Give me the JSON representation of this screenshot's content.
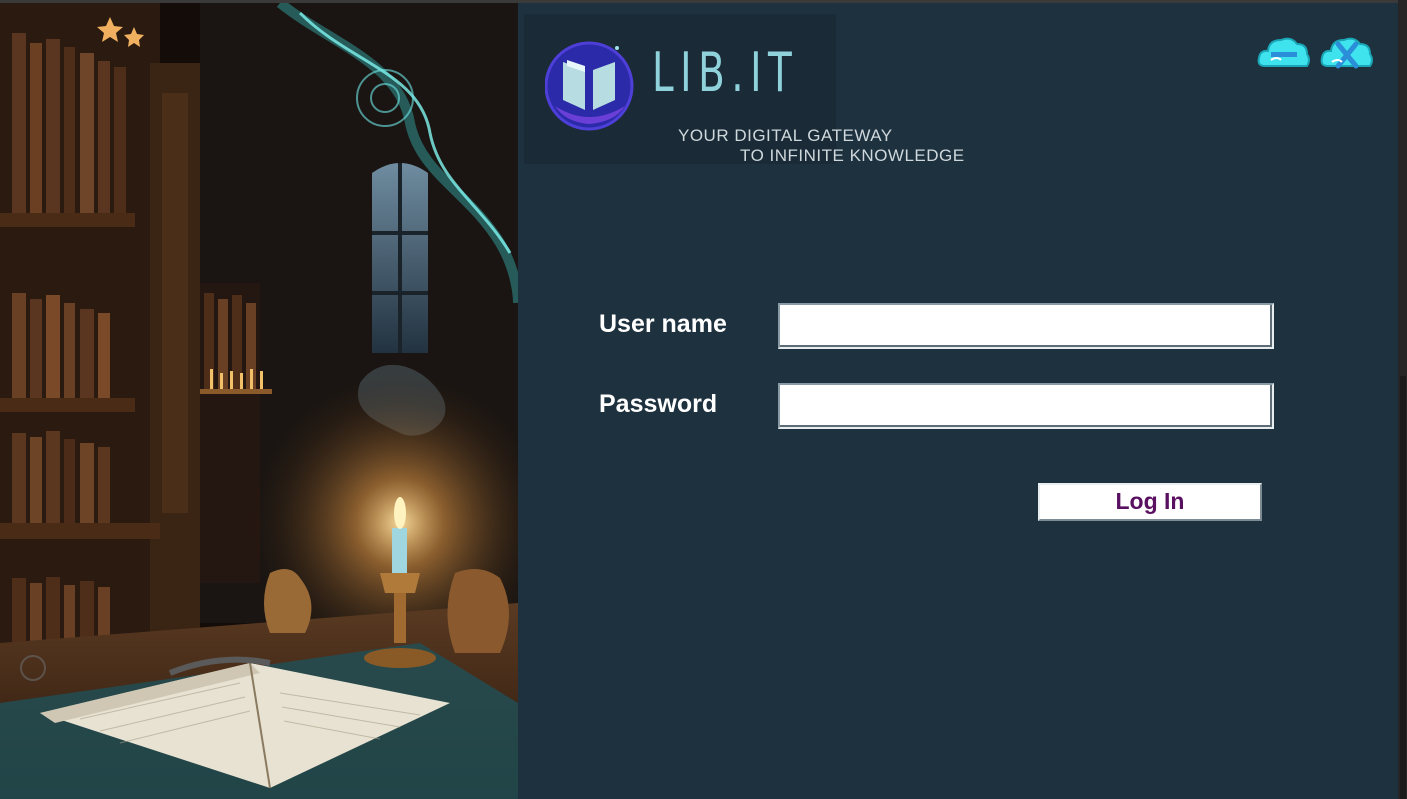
{
  "app": {
    "logo_text": "LIB.IT",
    "tagline_line1": "YOUR DIGITAL GATEWAY",
    "tagline_line2": "TO INFINITE KNOWLEDGE"
  },
  "window_controls": {
    "minimize_icon": "minimize-cloud-icon",
    "close_icon": "close-cloud-icon"
  },
  "form": {
    "username_label": "User name",
    "username_value": "",
    "password_label": "Password",
    "password_value": "",
    "login_label": "Log In"
  },
  "colors": {
    "background": "#1e313e",
    "logo_accent": "#8fd2dc",
    "button_text": "#5a1060",
    "cloud_icons": "#3fe3ee"
  }
}
